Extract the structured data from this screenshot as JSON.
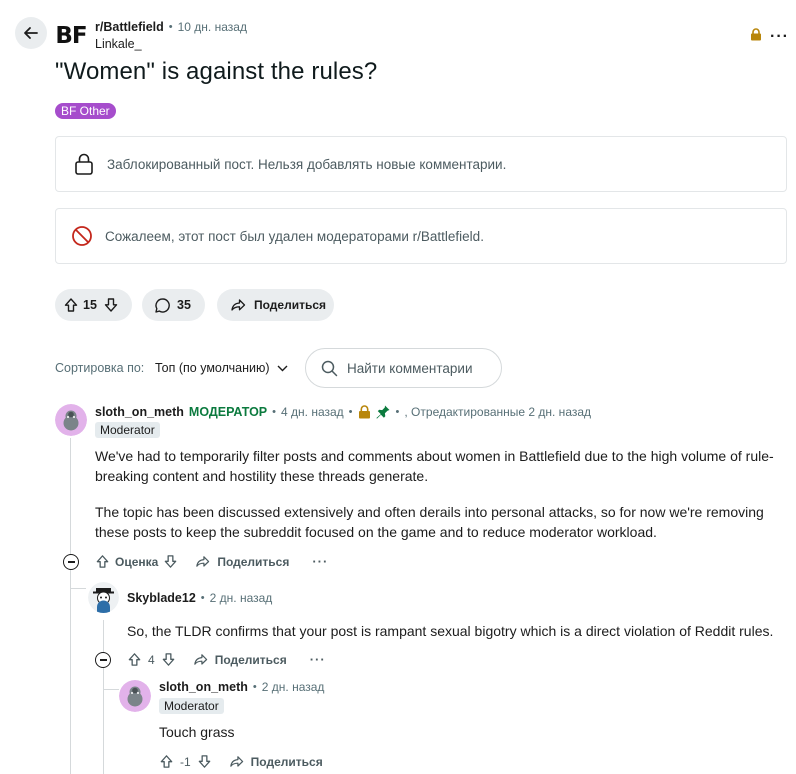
{
  "header": {
    "subreddit": "r/Battlefield",
    "subreddit_icon_text": "BF",
    "time_ago": "10 дн. назад",
    "author": "Linkale_",
    "more_label": "···"
  },
  "post": {
    "title": "\"Women\" is against the rules?",
    "flair": "BF Other",
    "locked_notice": "Заблокированный пост. Нельзя добавлять новые комментарии.",
    "removed_notice": "Сожалеем, этот пост был удален модераторами r/Battlefield.",
    "score": "15",
    "comments_count": "35",
    "share_label": "Поделиться"
  },
  "comments_toolbar": {
    "sort_label": "Сортировка по:",
    "sort_value": "Топ (по умолчанию)",
    "search_placeholder": "Найти комментарии"
  },
  "comments": [
    {
      "author": "sloth_on_meth",
      "mod_tag": "МОДЕРАТОР",
      "time_ago": "4 дн. назад",
      "edited": ", Отредактированные 2 дн. назад",
      "badge": "Moderator",
      "paragraphs": [
        "We've had to temporarily filter posts and comments about women in Battlefield due to the high volume of rule-breaking content and hostility these threads generate.",
        "The topic has been discussed extensively and often derails into personal attacks, so for now we're removing these posts to keep the subreddit focused on the game and to reduce moderator workload."
      ],
      "vote_label": "Оценка",
      "share_label": "Поделиться",
      "more_label": "···"
    },
    {
      "author": "Skyblade12",
      "time_ago": "2 дн. назад",
      "body": "So, the TLDR confirms that your post is rampant sexual bigotry which is a direct violation of Reddit rules.",
      "score": "4",
      "share_label": "Поделиться",
      "more_label": "···"
    },
    {
      "author": "sloth_on_meth",
      "time_ago": "2 дн. назад",
      "badge": "Moderator",
      "body": "Touch grass",
      "score": "-1",
      "share_label": "Поделиться"
    }
  ],
  "colors": {
    "flair_bg": "#a64dcc",
    "mod_green": "#0b7a3e",
    "pill_bg": "#eaedef",
    "lock_gold": "#b8860b",
    "removed_red": "#c4271c"
  }
}
